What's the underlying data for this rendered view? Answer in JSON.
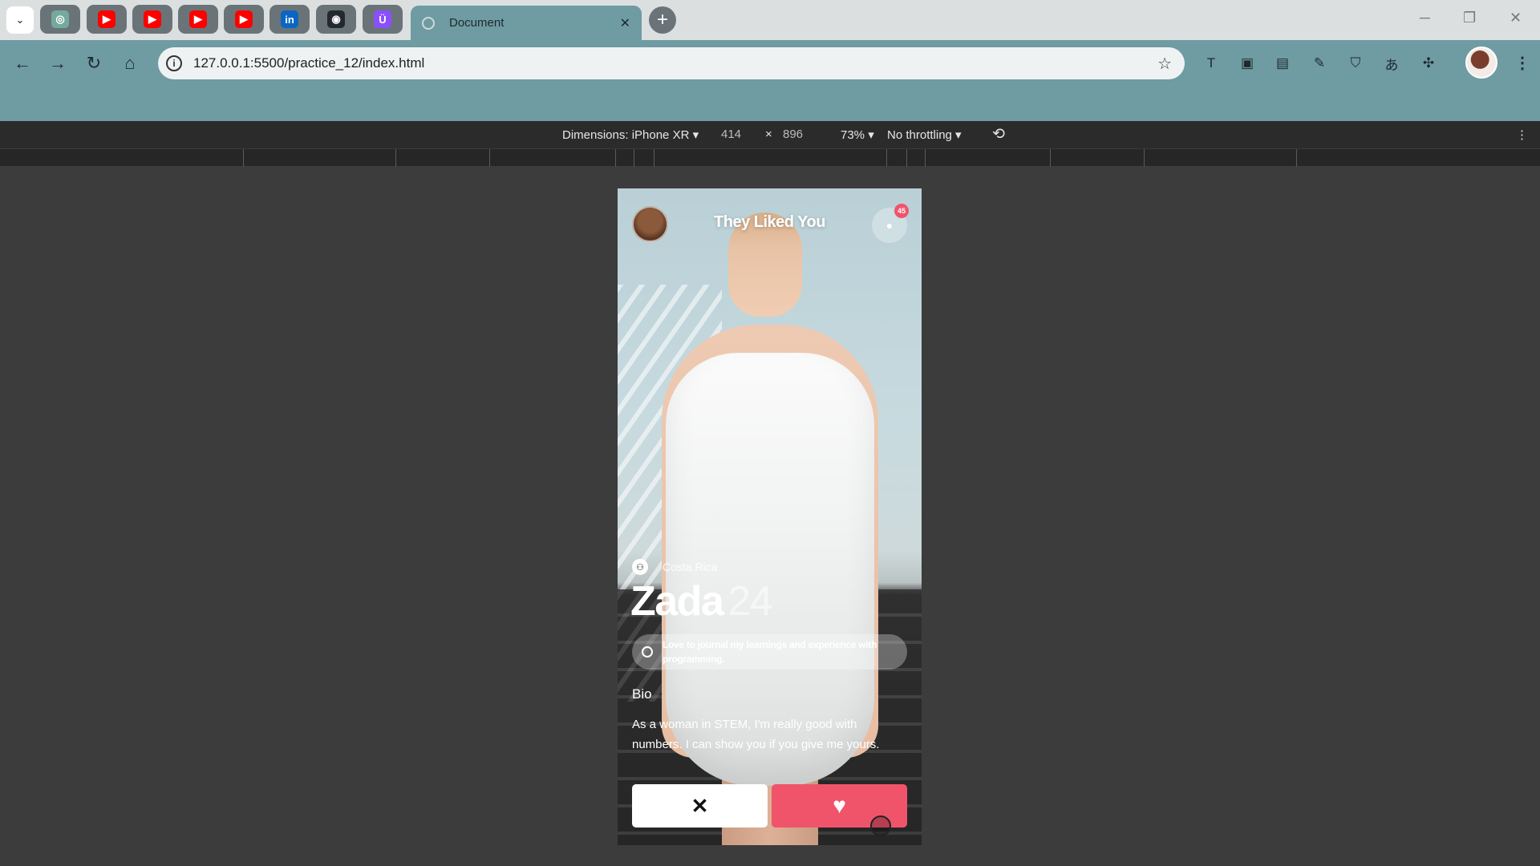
{
  "browser": {
    "active_tab": {
      "title": "Document",
      "close": "✕"
    },
    "new_tab": "+",
    "window_controls": {
      "minimize": "─",
      "maximize": "❐",
      "close": "✕"
    },
    "pinned_tabs": [
      {
        "icon": "chatgpt-icon",
        "glyph": "◎",
        "color": "#74aa9c"
      },
      {
        "icon": "youtube-icon",
        "glyph": "▶",
        "color": "#ff0000"
      },
      {
        "icon": "youtube-icon",
        "glyph": "▶",
        "color": "#ff0000"
      },
      {
        "icon": "youtube-icon",
        "glyph": "▶",
        "color": "#ff0000"
      },
      {
        "icon": "youtube-icon",
        "glyph": "▶",
        "color": "#ff0000"
      },
      {
        "icon": "linkedin-icon",
        "glyph": "in",
        "color": "#0a66c2"
      },
      {
        "icon": "github-icon",
        "glyph": "◉",
        "color": "#24292f"
      },
      {
        "icon": "proton-icon",
        "glyph": "Ü",
        "color": "#8a4fff"
      }
    ],
    "address": "127.0.0.1:5500/practice_12/index.html",
    "nav": {
      "back": "←",
      "forward": "→",
      "reload": "↻",
      "home": "⌂"
    }
  },
  "devtools": {
    "dimensions_label": "Dimensions: iPhone XR ▾",
    "width": "414",
    "times": "×",
    "height": "896",
    "zoom": "73% ▾",
    "throttling": "No throttling ▾",
    "rotate": "⟲",
    "more": "⋮"
  },
  "app": {
    "header_title": "They Liked You",
    "badge_count": "45",
    "location": "Costa Rica",
    "name": "Zada",
    "age": "24",
    "status": "Love to journal my learnings and experience with programming.",
    "bio_label": "Bio",
    "bio_text": "As a woman in STEM, I'm really good with numbers. I can show you if you give me yours.",
    "reject_glyph": "✕",
    "like_glyph": "♥",
    "accent_color": "#f0546b"
  }
}
